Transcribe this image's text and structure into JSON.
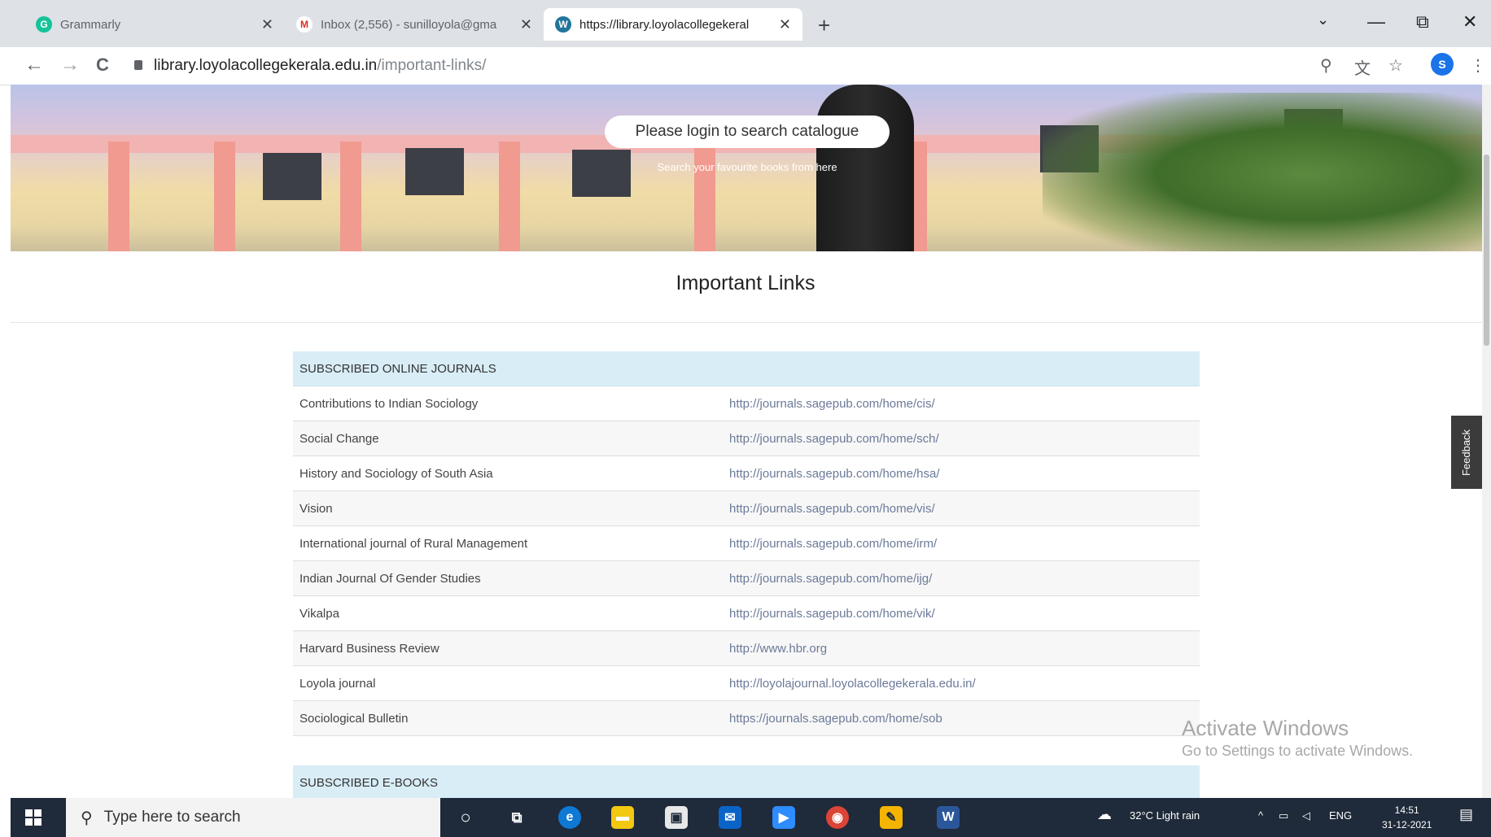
{
  "browser": {
    "tabs": [
      {
        "label": "Grammarly",
        "active": false
      },
      {
        "label": "Inbox (2,556) - sunilloyola@gma",
        "active": false
      },
      {
        "label": "https://library.loyolacollegekeral",
        "active": true
      }
    ],
    "new_tab": "+",
    "window_controls": {
      "dropdown": "⌄",
      "minimize": "—",
      "restore": "⧉",
      "close": "✕"
    },
    "nav": {
      "back": "←",
      "forward": "→",
      "reload": "C"
    },
    "url": {
      "host": "library.loyolacollegekerala.edu.in",
      "path": "/important-links/"
    },
    "profile_initial": "S"
  },
  "hero": {
    "login_button": "Please login to search catalogue",
    "subtitle": "Search your favourite books from here"
  },
  "page_title": "Important Links",
  "journals": {
    "heading": "SUBSCRIBED ONLINE JOURNALS",
    "rows": [
      {
        "name": "Contributions to Indian Sociology",
        "url": "http://journals.sagepub.com/home/cis/"
      },
      {
        "name": "Social Change",
        "url": "http://journals.sagepub.com/home/sch/"
      },
      {
        "name": "History and Sociology of South Asia",
        "url": "http://journals.sagepub.com/home/hsa/"
      },
      {
        "name": "Vision",
        "url": "http://journals.sagepub.com/home/vis/"
      },
      {
        "name": "International journal of Rural Management",
        "url": "http://journals.sagepub.com/home/irm/"
      },
      {
        "name": "Indian Journal Of Gender Studies",
        "url": "http://journals.sagepub.com/home/ijg/"
      },
      {
        "name": "Vikalpa",
        "url": "http://journals.sagepub.com/home/vik/"
      },
      {
        "name": "Harvard Business Review",
        "url": "http://www.hbr.org"
      },
      {
        "name": "Loyola journal",
        "url": "http://loyolajournal.loyolacollegekerala.edu.in/"
      },
      {
        "name": "Sociological Bulletin",
        "url": "https://journals.sagepub.com/home/sob"
      }
    ]
  },
  "ebooks": {
    "heading": "SUBSCRIBED E-BOOKS"
  },
  "feedback_label": "Feedback",
  "activate_windows": {
    "title": "Activate Windows",
    "subtitle": "Go to Settings to activate Windows."
  },
  "taskbar": {
    "search_placeholder": "Type here to search",
    "weather": "32°C Light rain",
    "language": "ENG",
    "time": "14:51",
    "date": "31-12-2021"
  },
  "colors": {
    "accent": "#1a73e8",
    "table_header": "#d9edf7",
    "taskbar": "#1f2a3a"
  }
}
